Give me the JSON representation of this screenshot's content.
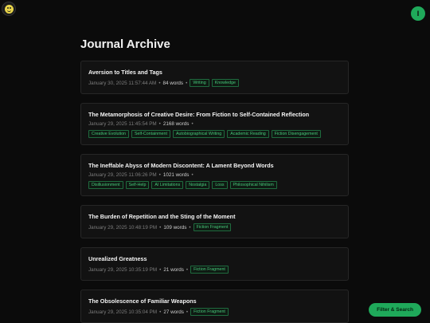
{
  "header": {
    "logo_icon": "smiley-face-icon",
    "avatar_initial": "I",
    "accent": "#1fa95a"
  },
  "page": {
    "title": "Journal Archive"
  },
  "entries": [
    {
      "title": "Aversion to Titles and Tags",
      "date": "January 30, 2025 11:57:44 AM",
      "words": "84 words",
      "tags": [
        "Writing",
        "Knowledge"
      ]
    },
    {
      "title": "The Metamorphosis of Creative Desire: From Fiction to Self-Contained Reflection",
      "date": "January 29, 2025 11:45:54 PM",
      "words": "2168 words",
      "tags": [
        "Creative Evolution",
        "Self-Containment",
        "Autobiographical Writing",
        "Academic Reading",
        "Fiction Disengagement"
      ]
    },
    {
      "title": "The Ineffable Abyss of Modern Discontent: A Lament Beyond Words",
      "date": "January 29, 2025 11:06:26 PM",
      "words": "1021 words",
      "tags": [
        "Disillusionment",
        "Self-Help",
        "AI Limitations",
        "Nostalgia",
        "Loss",
        "Philosophical Nihilism"
      ]
    },
    {
      "title": "The Burden of Repetition and the Sting of the Moment",
      "date": "January 29, 2025 10:48:19 PM",
      "words": "109 words",
      "tags": [
        "Fiction Fragment"
      ]
    },
    {
      "title": "Unrealized Greatness",
      "date": "January 29, 2025 10:35:19 PM",
      "words": "21 words",
      "tags": [
        "Fiction Fragment"
      ]
    },
    {
      "title": "The Obsolescence of Familiar Weapons",
      "date": "January 29, 2025 10:35:04 PM",
      "words": "27 words",
      "tags": [
        "Fiction Fragment"
      ]
    }
  ],
  "actions": {
    "filter_label": "Filter & Search"
  }
}
